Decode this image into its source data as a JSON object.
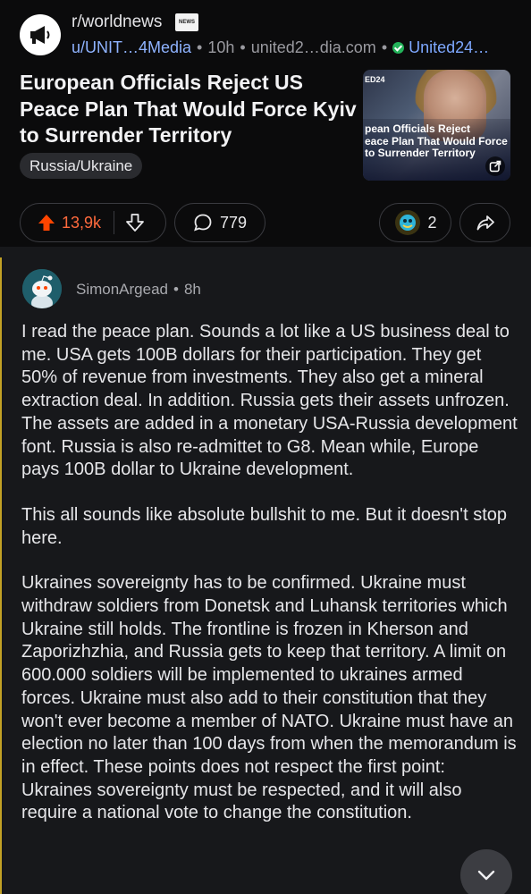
{
  "post": {
    "subreddit": "r/worldnews",
    "news_badge": "NEWS",
    "author": "u/UNIT…4Media",
    "age": "10h",
    "domain": "united2…dia.com",
    "flair": "United24…",
    "title": "European Officials Reject US Peace Plan That Would Force Kyiv to Surrender Territory",
    "tag": "Russia/Ukraine",
    "thumbnail": {
      "brand": "ED24",
      "caption_lines": [
        "pean Officials Reject",
        "eace Plan That Would Force",
        "to Surrender Territory"
      ]
    },
    "votes": "13,9k",
    "comments": "779",
    "awards": "2"
  },
  "comment": {
    "author": "SimonArgead",
    "age": "8h",
    "paragraphs": [
      "I read the peace plan. Sounds a lot like a US business deal to me. USA gets 100B dollars for their participation. They get 50% of revenue from investments. They also get a mineral extraction deal. In addition. Russia gets their assets unfrozen. The assets are added in a monetary USA-Russia development font. Russia is also re-admittet to G8.  Mean while, Europe pays 100B dollar to Ukraine development.",
      "This all sounds like absolute bullshit to me. But it doesn't stop here.",
      "Ukraines sovereignty has to be confirmed. Ukraine must withdraw soldiers from Donetsk and Luhansk territories which Ukraine still holds. The frontline is frozen in Kherson and Zaporizhzhia, and Russia gets to keep that territory. A limit on 600.000 soldiers will be implemented to ukraines armed forces. Ukraine must also add to their constitution that they won't ever become a member of NATO. Ukraine must have an election no later than 100 days from when the memorandum is in effect. These points does not respect the first point: Ukraines sovereignty must be respected, and it will also require a national vote to change the constitution."
    ]
  },
  "icons": {
    "subreddit": "megaphone-icon",
    "verified": "check-circle-icon",
    "upvote": "arrow-up-icon",
    "downvote": "arrow-down-icon",
    "comments": "speech-bubble-icon",
    "award": "award-icon",
    "share": "share-icon",
    "external": "external-link-icon",
    "scroll": "chevron-down-icon"
  },
  "colors": {
    "upvote": "#ff4500",
    "vote_count": "#ff6a3d",
    "link": "#8fb3ff",
    "verified": "#23b35a",
    "thread_line": "#c2a125"
  }
}
